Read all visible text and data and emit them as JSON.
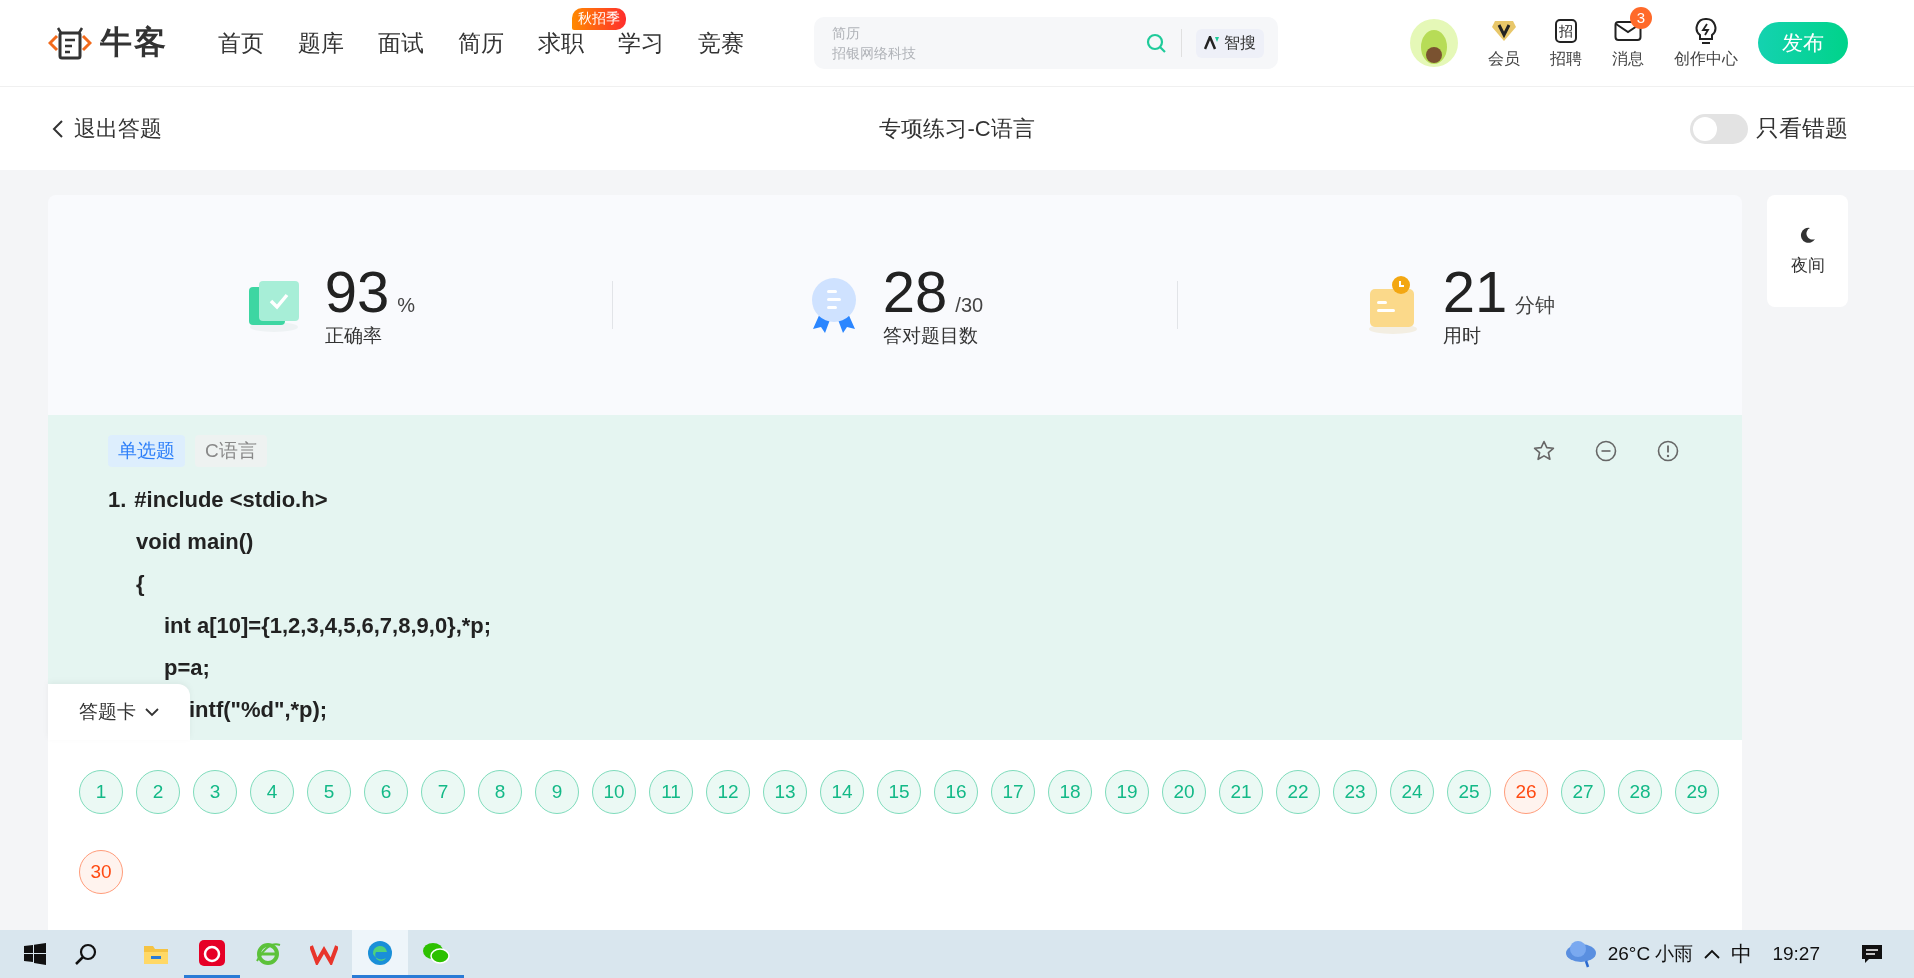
{
  "header": {
    "logo_text": "牛客",
    "nav": [
      {
        "label": "首页"
      },
      {
        "label": "题库"
      },
      {
        "label": "面试"
      },
      {
        "label": "简历"
      },
      {
        "label": "求职",
        "badge": "秋招季"
      },
      {
        "label": "学习"
      },
      {
        "label": "竞赛"
      }
    ],
    "search": {
      "suggestions": [
        "简历",
        "招银网络科技"
      ],
      "ai_label": "智搜"
    },
    "actions": [
      {
        "kind": "vip",
        "label": "会员"
      },
      {
        "kind": "jobs",
        "label": "招聘",
        "glyph": "招"
      },
      {
        "kind": "messages",
        "label": "消息",
        "badge": "3"
      },
      {
        "kind": "create",
        "label": "创作中心"
      }
    ],
    "publish": "发布"
  },
  "subheader": {
    "back": "退出答题",
    "title": "专项练习-C语言",
    "filter": {
      "label": "只看错题",
      "on": false
    }
  },
  "stats": [
    {
      "kind": "accuracy",
      "value": "93",
      "unit": "%",
      "label": "正确率"
    },
    {
      "kind": "correct",
      "value": "28",
      "unit": "/30",
      "label": "答对题目数"
    },
    {
      "kind": "time",
      "value": "21",
      "unit": "分钟",
      "label": "用时"
    }
  ],
  "night_mode": {
    "label": "夜间"
  },
  "question": {
    "tags": [
      {
        "kind": "type",
        "label": "单选题"
      },
      {
        "kind": "topic",
        "label": "C语言"
      }
    ],
    "number": "1.",
    "lines": [
      {
        "kind": "head",
        "text": "#include <stdio.h>"
      },
      {
        "kind": "outer",
        "text": "void main()"
      },
      {
        "kind": "outer",
        "text": "{"
      },
      {
        "kind": "inner",
        "text": "int a[10]={1,2,3,4,5,6,7,8,9,0},*p;"
      },
      {
        "kind": "inner",
        "text": "p=a;"
      },
      {
        "kind": "covered",
        "text": "intf(\"%d\",*p);"
      }
    ]
  },
  "answer_card": {
    "label": "答题卡",
    "answers": [
      {
        "label": "1",
        "correct": true
      },
      {
        "label": "2",
        "correct": true
      },
      {
        "label": "3",
        "correct": true
      },
      {
        "label": "4",
        "correct": true
      },
      {
        "label": "5",
        "correct": true
      },
      {
        "label": "6",
        "correct": true
      },
      {
        "label": "7",
        "correct": true
      },
      {
        "label": "8",
        "correct": true
      },
      {
        "label": "9",
        "correct": true
      },
      {
        "label": "10",
        "correct": true
      },
      {
        "label": "11",
        "correct": true
      },
      {
        "label": "12",
        "correct": true
      },
      {
        "label": "13",
        "correct": true
      },
      {
        "label": "14",
        "correct": true
      },
      {
        "label": "15",
        "correct": true
      },
      {
        "label": "16",
        "correct": true
      },
      {
        "label": "17",
        "correct": true
      },
      {
        "label": "18",
        "correct": true
      },
      {
        "label": "19",
        "correct": true
      },
      {
        "label": "20",
        "correct": true
      },
      {
        "label": "21",
        "correct": true
      },
      {
        "label": "22",
        "correct": true
      },
      {
        "label": "23",
        "correct": true
      },
      {
        "label": "24",
        "correct": true
      },
      {
        "label": "25",
        "correct": true
      },
      {
        "label": "26",
        "correct": false
      },
      {
        "label": "27",
        "correct": true
      },
      {
        "label": "28",
        "correct": true
      },
      {
        "label": "29",
        "correct": true
      },
      {
        "label": "30",
        "correct": false
      }
    ]
  },
  "taskbar": {
    "apps": [
      {
        "kind": "files",
        "running": false,
        "selected": false
      },
      {
        "kind": "music",
        "running": true,
        "selected": false
      },
      {
        "kind": "ie",
        "running": false,
        "selected": false
      },
      {
        "kind": "wps",
        "running": false,
        "selected": false
      },
      {
        "kind": "edge",
        "running": true,
        "selected": true
      },
      {
        "kind": "chat",
        "running": true,
        "selected": false
      }
    ],
    "weather": "26°C 小雨",
    "ime": "中",
    "time": "19:27"
  }
}
